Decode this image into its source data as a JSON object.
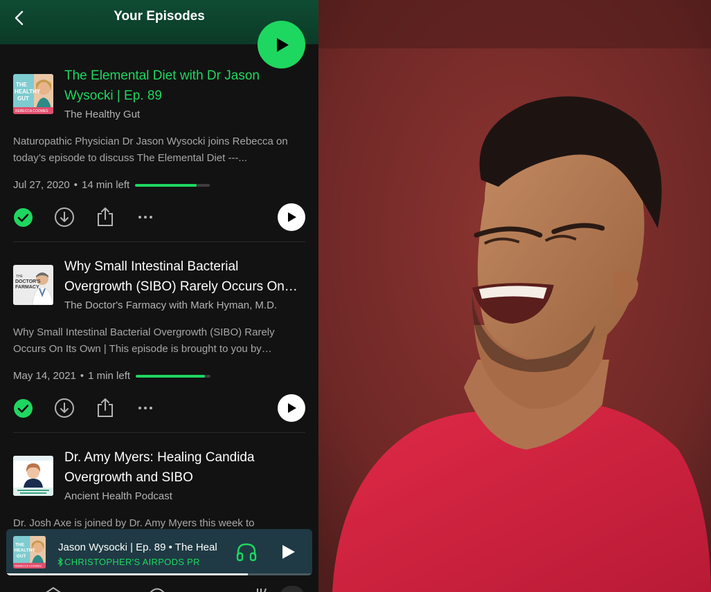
{
  "header": {
    "title": "Your Episodes"
  },
  "episodes": [
    {
      "title": "The Elemental Diet with Dr Jason Wysocki | Ep. 89",
      "show": "The Healthy Gut",
      "description": "Naturopathic Physician Dr Jason Wysocki joins Rebecca on today’s episode to discuss The Elemental Diet ---...",
      "date": "Jul 27, 2020",
      "remaining": "14 min left",
      "progress": 0.82,
      "cover": {
        "line1": "THE",
        "line2": "HEALTHY",
        "line3": "GUT",
        "line4": "REBECCA COOMES"
      }
    },
    {
      "title": "Why Small Intestinal Bacterial Overgrowth (SIBO) Rarely Occurs On…",
      "show": "The Doctor's Farmacy with Mark Hyman, M.D.",
      "description": "Why Small Intestinal Bacterial Overgrowth (SIBO) Rarely Occurs On Its Own | This episode is brought to you by…",
      "date": "May 14, 2021",
      "remaining": "1 min left",
      "progress": 0.93,
      "cover": {
        "line1": "THE",
        "line2": "DOCTOR'S",
        "line3": "FARMACY"
      }
    },
    {
      "title": "Dr. Amy Myers: Healing Candida Overgrowth and SIBO",
      "show": "Ancient Health Podcast",
      "description": "Dr. Josh Axe is joined by Dr. Amy Myers this week to"
    }
  ],
  "mini_player": {
    "title": "Jason Wysocki | Ep. 89 • The Heal",
    "device": "CHRISTOPHER'S AIRPODS PR",
    "progress": 0.79,
    "cover": {
      "line1": "THE",
      "line2": "HEALTHY",
      "line3": "GUT",
      "line4": "REBECCA COOMES"
    }
  },
  "colors": {
    "accent": "#1ed760",
    "background": "#121212",
    "header": "#0f4c33",
    "mini_player": "#1f3a44",
    "photo_wall": "#7a2a28",
    "shirt": "#d4203f"
  },
  "icons": [
    "chevron-left-icon",
    "play-icon",
    "check-circle-icon",
    "download-icon",
    "share-icon",
    "more-icon",
    "headphones-icon",
    "bluetooth-icon"
  ]
}
